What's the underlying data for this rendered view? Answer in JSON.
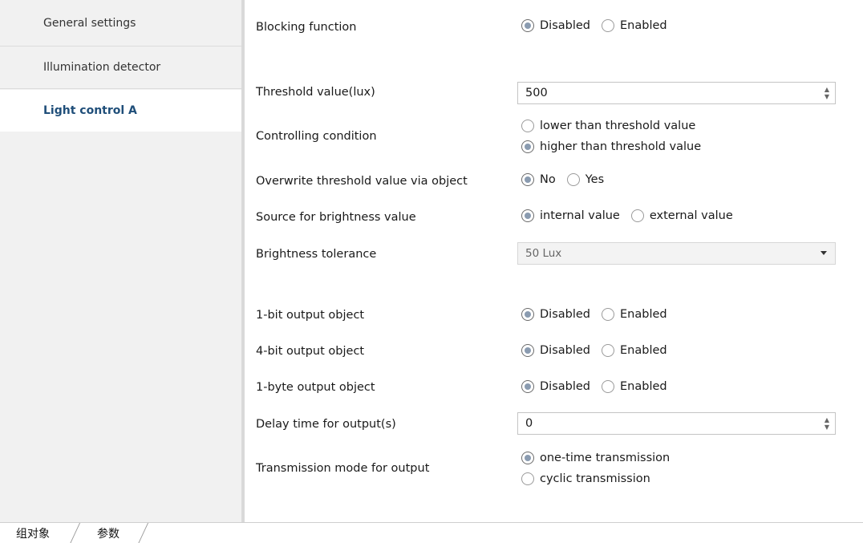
{
  "sidebar": {
    "items": [
      {
        "label": "General settings",
        "active": false
      },
      {
        "label": "Illumination detector",
        "active": false
      },
      {
        "label": "Light control A",
        "active": true
      }
    ]
  },
  "params": {
    "blocking": {
      "label": "Blocking function",
      "options": [
        "Disabled",
        "Enabled"
      ],
      "selected": "Disabled"
    },
    "threshold": {
      "label": "Threshold value(lux)",
      "value": "500"
    },
    "condition": {
      "label": "Controlling condition",
      "options": [
        "lower than threshold value",
        "higher than threshold value"
      ],
      "selected": "higher than threshold value"
    },
    "overwrite": {
      "label": "Overwrite threshold value via object",
      "options": [
        "No",
        "Yes"
      ],
      "selected": "No"
    },
    "source": {
      "label": "Source for brightness value",
      "options": [
        "internal value",
        "external value"
      ],
      "selected": "internal value"
    },
    "tolerance": {
      "label": "Brightness tolerance",
      "value": "50 Lux"
    },
    "out1bit": {
      "label": "1-bit output object",
      "options": [
        "Disabled",
        "Enabled"
      ],
      "selected": "Disabled"
    },
    "out4bit": {
      "label": "4-bit output object",
      "options": [
        "Disabled",
        "Enabled"
      ],
      "selected": "Disabled"
    },
    "out1byte": {
      "label": "1-byte output object",
      "options": [
        "Disabled",
        "Enabled"
      ],
      "selected": "Disabled"
    },
    "delay": {
      "label": "Delay time for output(s)",
      "value": "0"
    },
    "transmission": {
      "label": "Transmission mode for output",
      "options": [
        "one-time transmission",
        "cyclic transmission"
      ],
      "selected": "one-time transmission"
    }
  },
  "bottom_tabs": [
    {
      "label": "组对象",
      "active": false
    },
    {
      "label": "参数",
      "active": true
    }
  ]
}
